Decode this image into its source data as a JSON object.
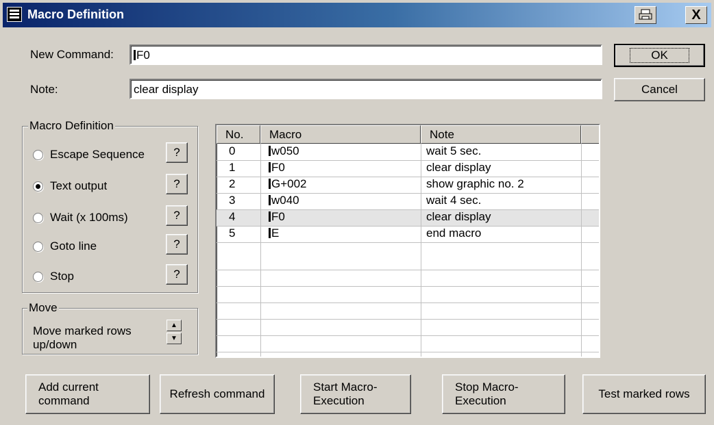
{
  "window": {
    "title": "Macro Definition",
    "icons": [
      "system-menu-icon",
      "printer-icon",
      "close-icon"
    ],
    "close_label": "X"
  },
  "form": {
    "new_command_label": "New Command:",
    "new_command_value": "F0",
    "note_label": "Note:",
    "note_value": "clear display"
  },
  "buttons": {
    "ok": "OK",
    "cancel": "Cancel",
    "add_current": "Add current command",
    "refresh": "Refresh command",
    "start": "Start Macro-Execution",
    "stop": "Stop Macro-Execution",
    "test": "Test marked rows"
  },
  "macro_group": {
    "label": "Macro Definition",
    "help_label": "?",
    "options": [
      {
        "label": "Escape Sequence",
        "checked": false
      },
      {
        "label": "Text output",
        "checked": true
      },
      {
        "label": "Wait (x 100ms)",
        "checked": false
      },
      {
        "label": "Goto line",
        "checked": false
      },
      {
        "label": "Stop",
        "checked": false
      }
    ]
  },
  "move_group": {
    "label": "Move",
    "text": "Move marked rows up/down"
  },
  "table": {
    "columns": [
      "No.",
      "Macro",
      "Note"
    ],
    "rows": [
      {
        "no": "0",
        "macro": "w050",
        "note": "wait 5 sec.",
        "selected": false
      },
      {
        "no": "1",
        "macro": "F0",
        "note": "clear display",
        "selected": false
      },
      {
        "no": "2",
        "macro": "G+002",
        "note": "show graphic no. 2",
        "selected": false
      },
      {
        "no": "3",
        "macro": "w040",
        "note": "wait 4 sec.",
        "selected": false
      },
      {
        "no": "4",
        "macro": "F0",
        "note": "clear display",
        "selected": true
      },
      {
        "no": "5",
        "macro": "E",
        "note": "end macro",
        "selected": false
      }
    ]
  }
}
